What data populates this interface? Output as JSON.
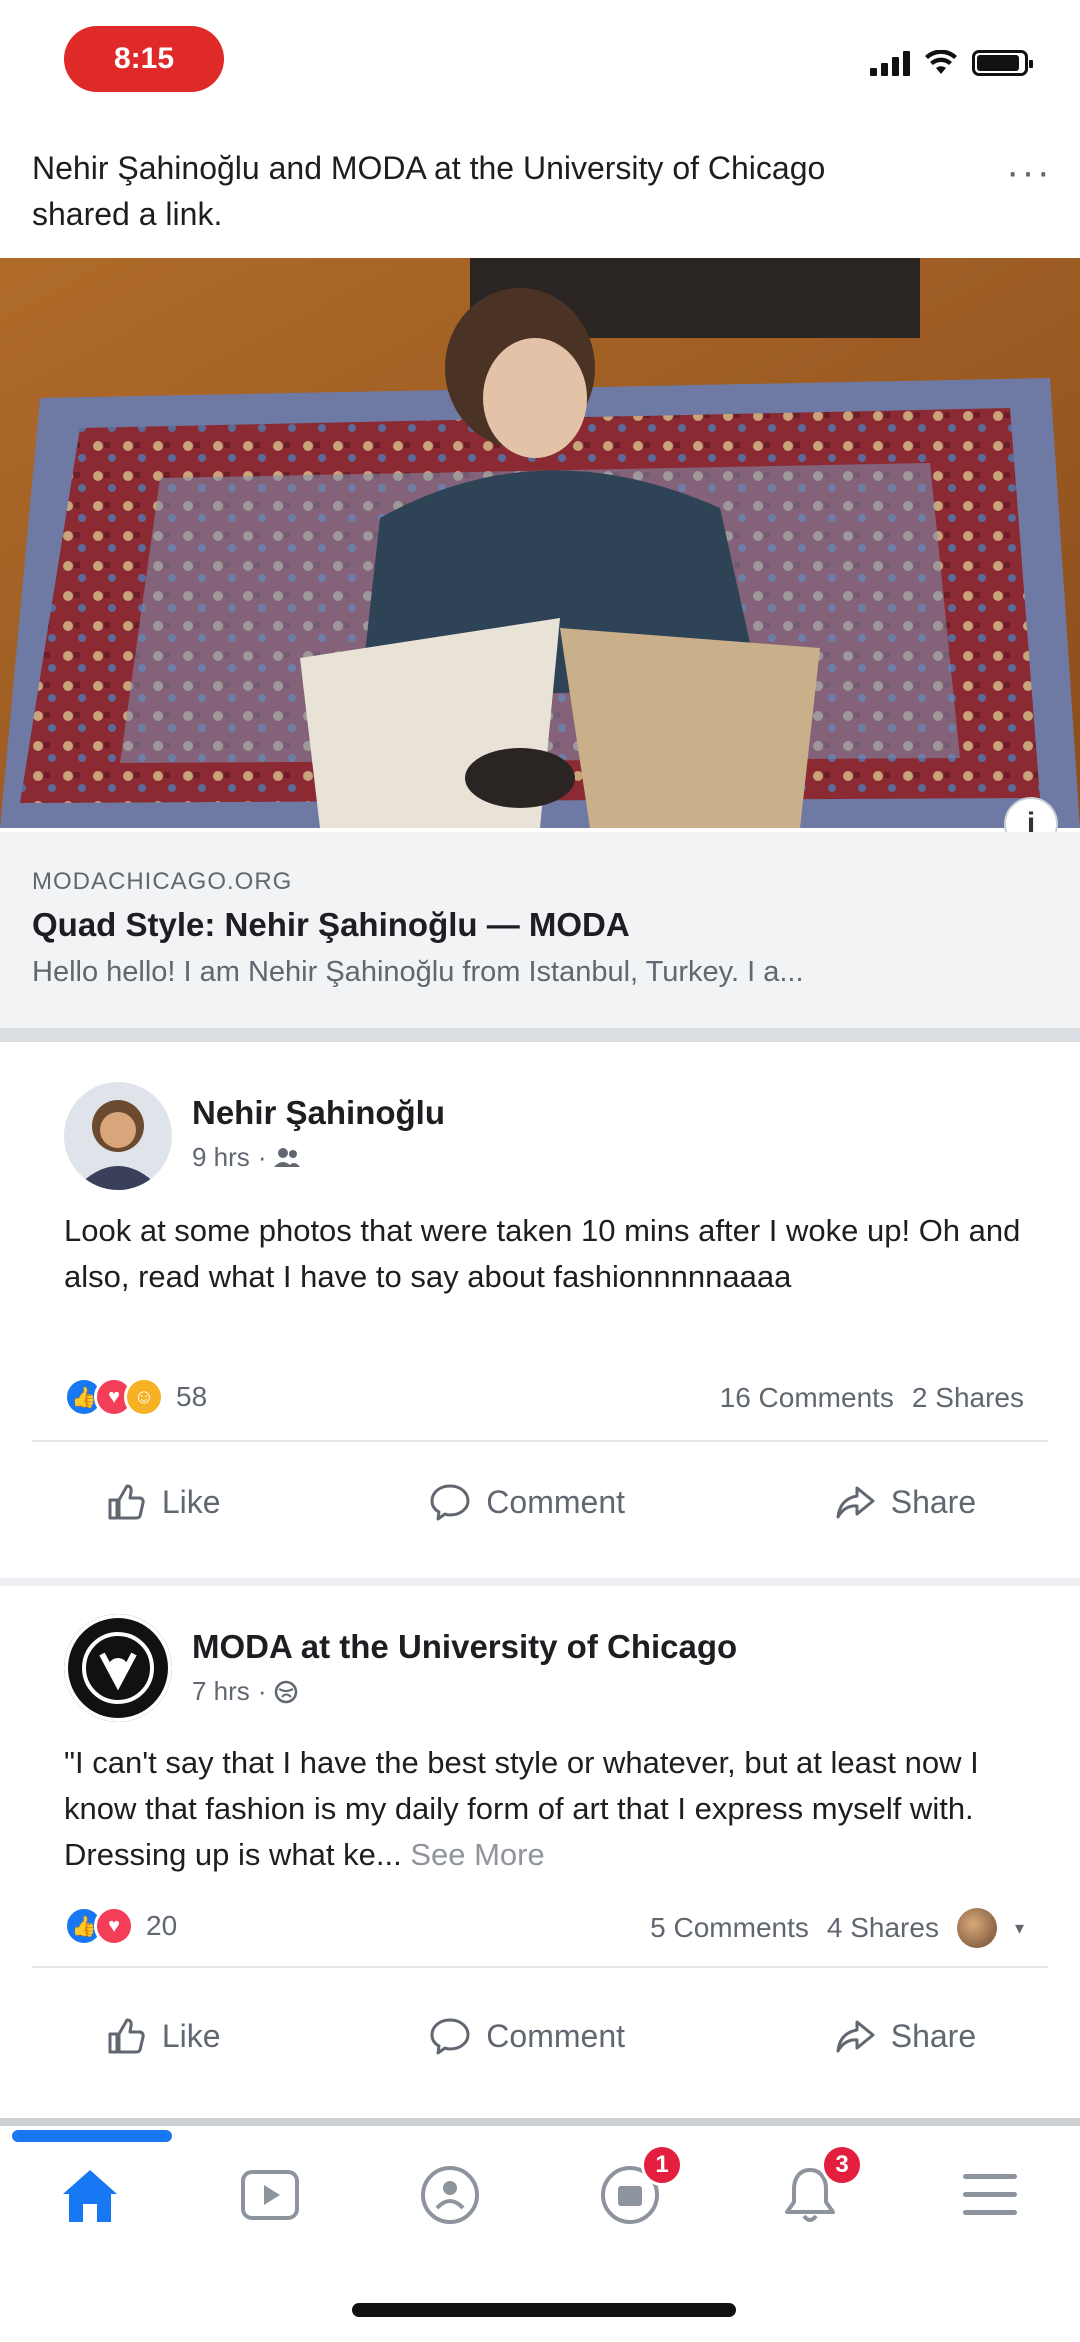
{
  "status_bar": {
    "time": "8:15"
  },
  "shared_header": {
    "text": "Nehir Şahinoğlu and MODA at the University of Chicago shared a link.",
    "more": "···"
  },
  "link_preview": {
    "domain": "MODACHICAGO.ORG",
    "title": "Quad Style: Nehir Şahinoğlu — MODA",
    "description": "Hello hello! I am Nehir Şahinoğlu from Istanbul, Turkey. I a..."
  },
  "posts": [
    {
      "author": "Nehir Şahinoğlu",
      "meta_time": "9 hrs",
      "text": "Look at some photos that were taken 10 mins after I woke up! Oh and also, read what I have to say about fashionnnnnaaaa",
      "see_more": "",
      "reaction_count": "58",
      "comments": "16 Comments",
      "shares": "2 Shares"
    },
    {
      "author": "MODA at the University of Chicago",
      "meta_time": "7 hrs",
      "text": "\"I can't say that I have the best style or whatever, but at least now I know that fashion is my daily form of art that I express myself with. Dressing up is what ke...",
      "see_more": "See More",
      "reaction_count": "20",
      "comments": "5 Comments",
      "shares": "4 Shares"
    }
  ],
  "actions": {
    "like": "Like",
    "comment": "Comment",
    "share": "Share"
  },
  "bottom_nav": {
    "items": [
      "home-icon",
      "watch-icon",
      "groups-icon",
      "marketplace-icon",
      "notifications-icon",
      "menu-icon"
    ],
    "marketplace_badge": "1",
    "notifications_badge": "3"
  },
  "colors": {
    "accent": "#1877f2",
    "badge": "#e41e3f",
    "time_pill": "#e02a2a"
  }
}
